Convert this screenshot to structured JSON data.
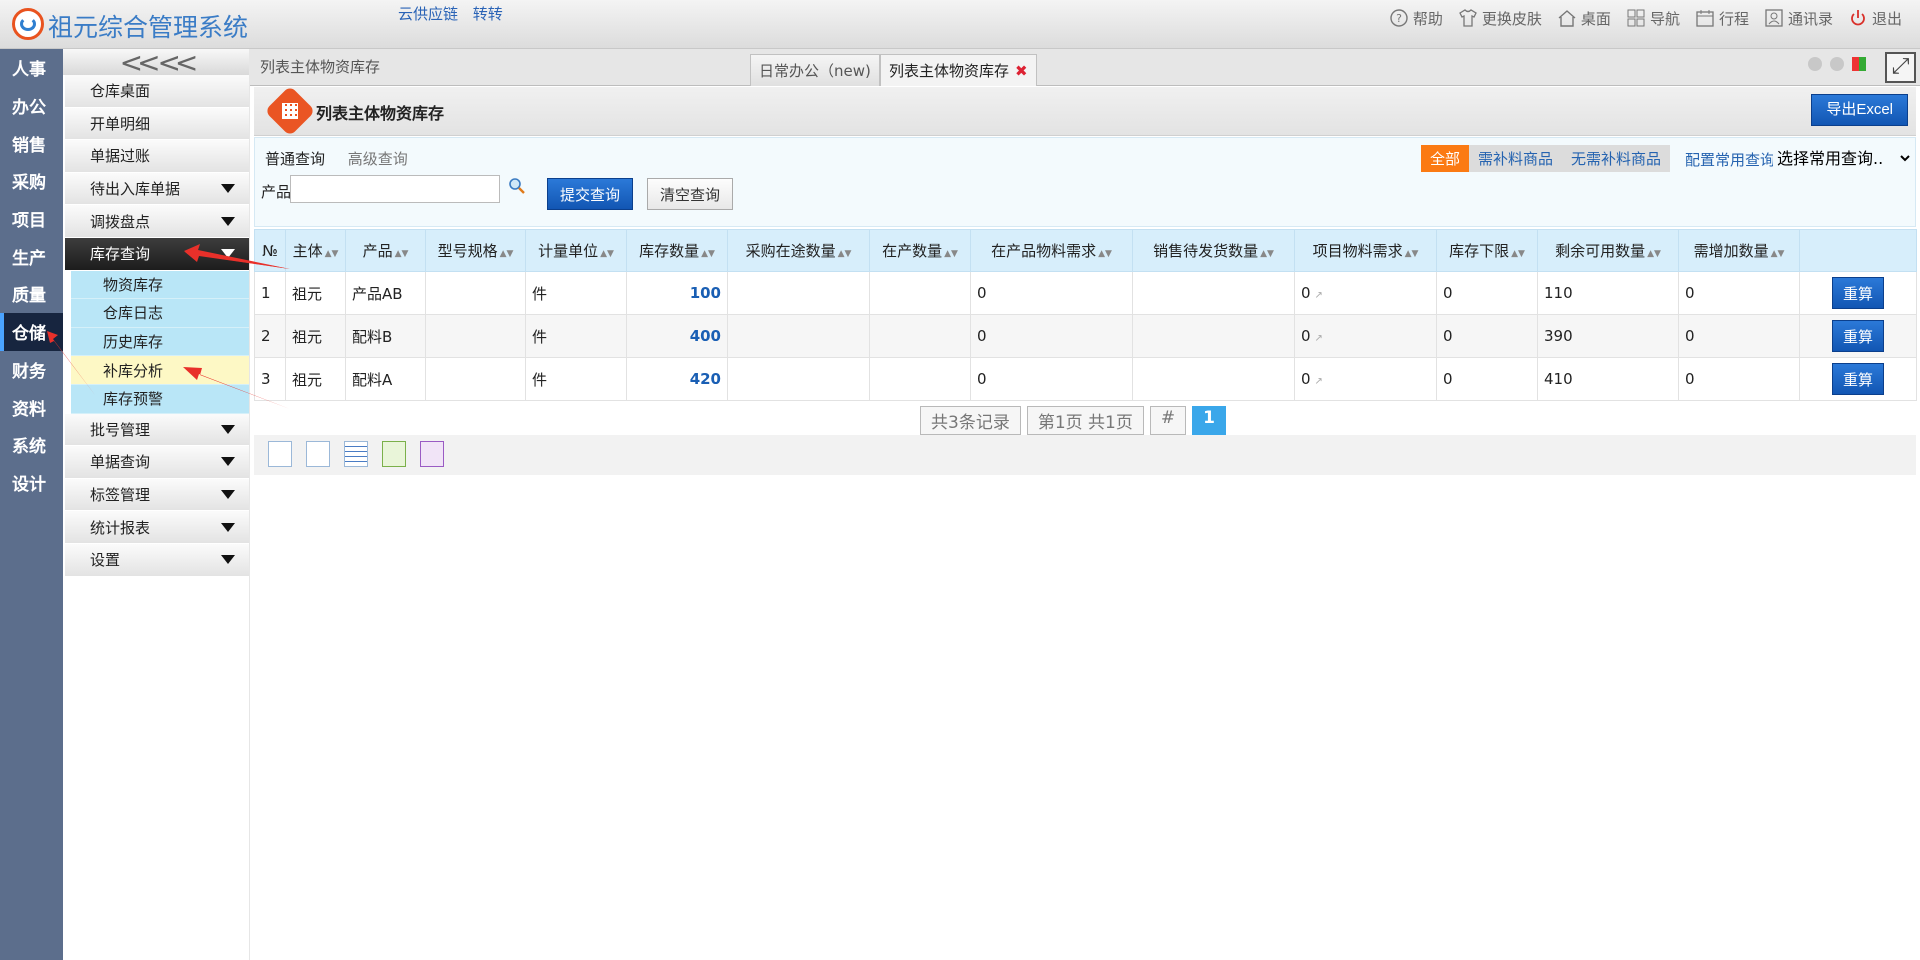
{
  "app": {
    "title": "祖元综合管理系统",
    "top_links": [
      "云供应链",
      "转转"
    ],
    "tools": [
      {
        "label": "帮助",
        "icon": "help-icon"
      },
      {
        "label": "更换皮肤",
        "icon": "shirt-icon"
      },
      {
        "label": "桌面",
        "icon": "home-icon"
      },
      {
        "label": "导航",
        "icon": "grid-icon"
      },
      {
        "label": "行程",
        "icon": "calendar-icon"
      },
      {
        "label": "通讯录",
        "icon": "contacts-icon"
      },
      {
        "label": "退出",
        "icon": "power-icon"
      }
    ]
  },
  "left_nav": [
    "人事",
    "办公",
    "销售",
    "采购",
    "项目",
    "生产",
    "质量",
    "仓储",
    "财务",
    "资料",
    "系统",
    "设计"
  ],
  "left_nav_active": "仓储",
  "side_menu": {
    "items": [
      {
        "label": "仓库桌面",
        "arrow": false
      },
      {
        "label": "开单明细",
        "arrow": false
      },
      {
        "label": "单据过账",
        "arrow": false
      },
      {
        "label": "待出入库单据",
        "arrow": true
      },
      {
        "label": "调拨盘点",
        "arrow": true
      },
      {
        "label": "库存查询",
        "arrow": true
      }
    ],
    "sub_items": [
      "物资库存",
      "仓库日志",
      "历史库存",
      "补库分析",
      "库存预警"
    ],
    "more_items": [
      "批号管理",
      "单据查询",
      "标签管理",
      "统计报表",
      "设置"
    ]
  },
  "tabs": {
    "breadcrumb": "列表主体物资库存",
    "items": [
      "日常办公（new)",
      "列表主体物资库存"
    ]
  },
  "page": {
    "title": "列表主体物资库存",
    "export_label": "导出Excel"
  },
  "query": {
    "tabs": [
      "普通查询",
      "高级查询"
    ],
    "filters": [
      "全部",
      "需补料商品",
      "无需补料商品"
    ],
    "config_label": "配置常用查询",
    "select_label": "选择常用查询..",
    "product_label": "产品",
    "product_value": "",
    "submit_label": "提交查询",
    "clear_label": "清空查询"
  },
  "table": {
    "headers": [
      "№",
      "主体",
      "产品",
      "型号规格",
      "计量单位",
      "库存数量",
      "采购在途数量",
      "在产数量",
      "在产品物料需求",
      "销售待发货数量",
      "项目物料需求",
      "库存下限",
      "剩余可用数量",
      "需增加数量",
      ""
    ],
    "rows": [
      {
        "no": "1",
        "entity": "祖元",
        "product": "产品AB",
        "spec": "",
        "unit": "件",
        "stock": "100",
        "purchase_transit": "",
        "in_production": "",
        "wip_demand": "0",
        "sales_pending": "",
        "project_demand": "0",
        "min_stock": "0",
        "available": "110",
        "need_add": "0",
        "action": "重算"
      },
      {
        "no": "2",
        "entity": "祖元",
        "product": "配料B",
        "spec": "",
        "unit": "件",
        "stock": "400",
        "purchase_transit": "",
        "in_production": "",
        "wip_demand": "0",
        "sales_pending": "",
        "project_demand": "0",
        "min_stock": "0",
        "available": "390",
        "need_add": "0",
        "action": "重算"
      },
      {
        "no": "3",
        "entity": "祖元",
        "product": "配料A",
        "spec": "",
        "unit": "件",
        "stock": "420",
        "purchase_transit": "",
        "in_production": "",
        "wip_demand": "0",
        "sales_pending": "",
        "project_demand": "0",
        "min_stock": "0",
        "available": "410",
        "need_add": "0",
        "action": "重算"
      }
    ]
  },
  "pager": {
    "records": "共3条记录",
    "pages": "第1页 共1页",
    "hash": "#",
    "current": "1"
  },
  "colors": {
    "accent": "#1256b3",
    "nav_bg": "#5c6e8c",
    "filter_active": "#fb7a13",
    "arrow": "#e8302a"
  }
}
